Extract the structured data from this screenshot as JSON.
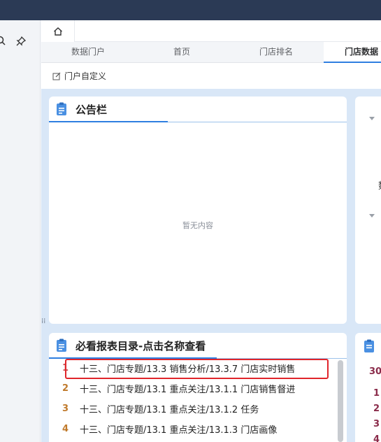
{
  "tabs": [
    {
      "label": "数据门户"
    },
    {
      "label": "首页"
    },
    {
      "label": "门店排名"
    },
    {
      "label": "门店数据"
    }
  ],
  "toolbar": {
    "custom_label": "门户自定义"
  },
  "notice_card": {
    "title": "公告栏",
    "empty_text": "暂无内容"
  },
  "report_card": {
    "title": "必看报表目录-点击名称查看",
    "items": [
      {
        "num": "1",
        "text": "十三、门店专题/13.3 销售分析/13.3.7 门店实时销售"
      },
      {
        "num": "2",
        "text": "十三、门店专题/13.1 重点关注/13.1.1 门店销售督进"
      },
      {
        "num": "3",
        "text": "十三、门店专题/13.1 重点关注/13.1.2 任务"
      },
      {
        "num": "4",
        "text": "十三、门店专题/13.1 重点关注/13.1.3 门店画像"
      }
    ]
  },
  "right_panel": {
    "partial_char": "数",
    "numbers": [
      "30",
      "1",
      "2",
      "3",
      "4"
    ]
  },
  "colors": {
    "accent": "#2f7fe0",
    "topbar": "#2b3a55",
    "canvas": "#d9e7f7",
    "highlight": "#e0252b"
  }
}
